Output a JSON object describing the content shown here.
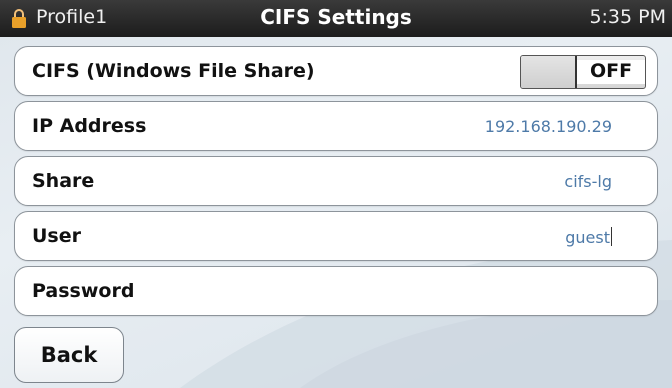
{
  "statusbar": {
    "profile": "Profile1",
    "title": "CIFS Settings",
    "time": "5:35 PM",
    "lock_icon": "lock-icon",
    "lock_color": "#e8a02a"
  },
  "rows": [
    {
      "label": "CIFS (Windows File Share)",
      "toggle_state": "OFF"
    },
    {
      "label": "IP Address",
      "value": "192.168.190.29"
    },
    {
      "label": "Share",
      "value": "cifs-lg"
    },
    {
      "label": "User",
      "value": "guest"
    },
    {
      "label": "Password",
      "value": ""
    }
  ],
  "footer": {
    "back_label": "Back"
  },
  "colors": {
    "value_text": "#4e7aa8",
    "statusbar_bg": "#222222"
  }
}
